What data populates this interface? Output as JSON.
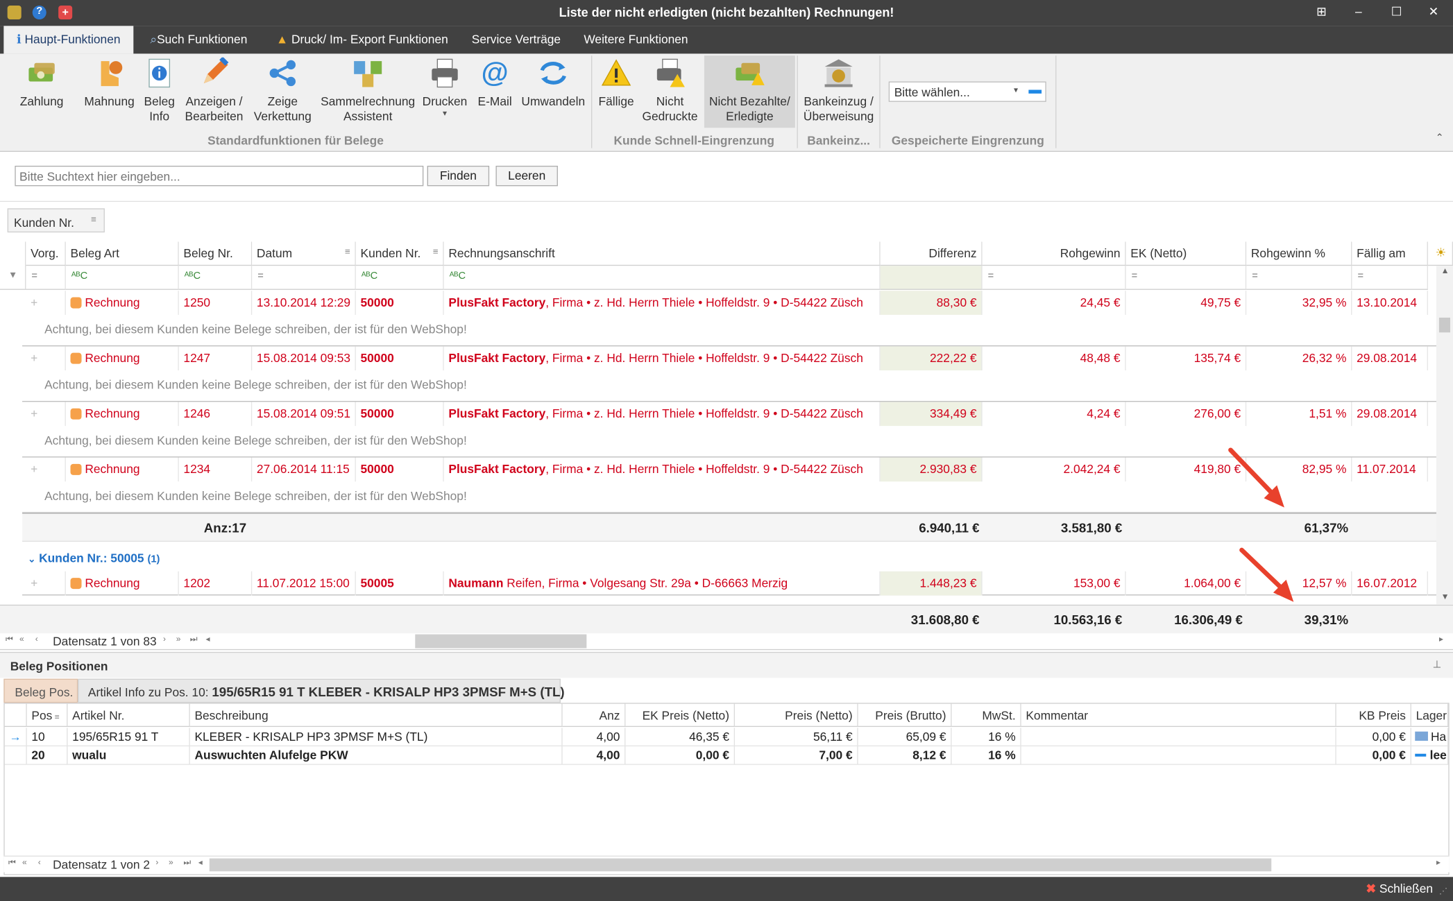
{
  "window": {
    "title": "Liste der nicht erledigten (nicht bezahlten) Rechnungen!",
    "controls": [
      "⊞",
      "–",
      "☐",
      "✕"
    ]
  },
  "tabs": [
    {
      "label": "Haupt-Funktionen",
      "active": true
    },
    {
      "label": "Such Funktionen"
    },
    {
      "label": "Druck/ Im- Export Funktionen"
    },
    {
      "label": "Service Verträge"
    },
    {
      "label": "Weitere Funktionen"
    }
  ],
  "ribbon": {
    "buttons": {
      "zahlung": "Zahlung",
      "mahnung": "Mahnung",
      "beleg_info": "Beleg\nInfo",
      "anzeigen": "Anzeigen /\nBearbeiten",
      "verkettung": "Zeige\nVerkettung",
      "sammel": "Sammelrechnung\nAssistent",
      "drucken": "Drucken",
      "email": "E-Mail",
      "umwandeln": "Umwandeln",
      "faellige": "Fällige",
      "nicht_gedruckte": "Nicht\nGedruckte",
      "nicht_bezahlte": "Nicht Bezahlte/\nErledigte",
      "bankeinzug": "Bankeinzug /\nÜberweisung"
    },
    "groups": {
      "standard": "Standardfunktionen für Belege",
      "kunde": "Kunde Schnell-Eingrenzung",
      "bank": "Bankeinz...",
      "gespeichert": "Gespeicherte Eingrenzung"
    },
    "select_placeholder": "Bitte wählen..."
  },
  "search": {
    "placeholder": "Bitte Suchtext hier eingeben...",
    "find": "Finden",
    "clear": "Leeren"
  },
  "group_chip": "Kunden Nr.",
  "columns": {
    "vorg": "Vorg.",
    "art": "Beleg Art",
    "nr": "Beleg Nr.",
    "datum": "Datum",
    "kunde": "Kunden Nr.",
    "anschrift": "Rechnungsanschrift",
    "differenz": "Differenz",
    "rohgewinn": "Rohgewinn",
    "ek": "EK (Netto)",
    "rohpct": "Rohgewinn %",
    "faellig": "Fällig am"
  },
  "rows": [
    {
      "art": "Rechnung",
      "nr": "1250",
      "datum": "13.10.2014 12:29",
      "kunde": "50000",
      "firma": "PlusFakt Factory",
      "adresse": ", Firma • z. Hd. Herrn Thiele • Hoffeldstr. 9 • D-54422 Züsch",
      "differenz": "88,30 €",
      "rohgewinn": "24,45 €",
      "ek": "49,75 €",
      "rohpct": "32,95 %",
      "faellig": "13.10.2014",
      "note": "Achtung, bei diesem Kunden keine Belege schreiben, der ist für den WebShop!"
    },
    {
      "art": "Rechnung",
      "nr": "1247",
      "datum": "15.08.2014 09:53",
      "kunde": "50000",
      "firma": "PlusFakt Factory",
      "adresse": ", Firma • z. Hd. Herrn Thiele • Hoffeldstr. 9 • D-54422 Züsch",
      "differenz": "222,22 €",
      "rohgewinn": "48,48 €",
      "ek": "135,74 €",
      "rohpct": "26,32 %",
      "faellig": "29.08.2014",
      "note": "Achtung, bei diesem Kunden keine Belege schreiben, der ist für den WebShop!"
    },
    {
      "art": "Rechnung",
      "nr": "1246",
      "datum": "15.08.2014 09:51",
      "kunde": "50000",
      "firma": "PlusFakt Factory",
      "adresse": ", Firma • z. Hd. Herrn Thiele • Hoffeldstr. 9 • D-54422 Züsch",
      "differenz": "334,49 €",
      "rohgewinn": "4,24 €",
      "ek": "276,00 €",
      "rohpct": "1,51 %",
      "faellig": "29.08.2014",
      "note": "Achtung, bei diesem Kunden keine Belege schreiben, der ist für den WebShop!"
    },
    {
      "art": "Rechnung",
      "nr": "1234",
      "datum": "27.06.2014 11:15",
      "kunde": "50000",
      "firma": "PlusFakt Factory",
      "adresse": ", Firma • z. Hd. Herrn Thiele • Hoffeldstr. 9 • D-54422 Züsch",
      "differenz": "2.930,83 €",
      "rohgewinn": "2.042,24 €",
      "ek": "419,80 €",
      "rohpct": "82,95 %",
      "faellig": "11.07.2014",
      "note": "Achtung, bei diesem Kunden keine Belege schreiben, der ist für den WebShop!"
    }
  ],
  "group_total": {
    "anz": "Anz:17",
    "differenz": "6.940,11 €",
    "rohgewinn": "3.581,80 €",
    "rohpct": "61,37%"
  },
  "group2": {
    "label": "Kunden Nr.: 50005",
    "count": "(1)"
  },
  "row2": {
    "art": "Rechnung",
    "nr": "1202",
    "datum": "11.07.2012 15:00",
    "kunde": "50005",
    "firma": "Naumann",
    "adresse": " Reifen, Firma • Volgesang Str. 29a • D-66663 Merzig",
    "differenz": "1.448,23 €",
    "rohgewinn": "153,00 €",
    "ek": "1.064,00 €",
    "rohpct": "12,57 %",
    "faellig": "16.07.2012"
  },
  "grand_total": {
    "differenz": "31.608,80 €",
    "rohgewinn": "10.563,16 €",
    "ek": "16.306,49 €",
    "rohpct": "39,31%"
  },
  "nav_top": "Datensatz 1 von 83",
  "bottom": {
    "title": "Beleg Positionen",
    "tab1": "Beleg Pos.",
    "tab2_prefix": "Artikel Info zu Pos. 10: ",
    "tab2_bold": "195/65R15 91 T KLEBER - KRISALP HP3 3PMSF M+S (TL)",
    "columns": {
      "pos": "Pos",
      "artnr": "Artikel Nr.",
      "beschr": "Beschreibung",
      "anz": "Anz",
      "ek": "EK Preis (Netto)",
      "preis": "Preis (Netto)",
      "brutto": "Preis (Brutto)",
      "mwst": "MwSt.",
      "komm": "Kommentar",
      "kb": "KB Preis",
      "lager": "Lager"
    },
    "rows": [
      {
        "pos": "10",
        "artnr": "195/65R15 91 T",
        "beschr": "KLEBER - KRISALP HP3 3PMSF M+S (TL)",
        "anz": "4,00",
        "ek": "46,35 €",
        "preis": "56,11 €",
        "brutto": "65,09 €",
        "mwst": "16 %",
        "komm": "",
        "kb": "0,00 €",
        "lager": "Ha"
      },
      {
        "pos": "20",
        "artnr": "wualu",
        "beschr": "Auswuchten Alufelge PKW",
        "anz": "4,00",
        "ek": "0,00 €",
        "preis": "7,00 €",
        "brutto": "8,12 €",
        "mwst": "16 %",
        "komm": "",
        "kb": "0,00 €",
        "lager": "lee"
      }
    ],
    "nav": "Datensatz 1 von 2"
  },
  "status": {
    "close": "Schließen"
  },
  "colors": {
    "accent": "#1f6fc5",
    "red": "#d0021b",
    "titlebar": "#414141",
    "arrow": "#e8412c"
  }
}
